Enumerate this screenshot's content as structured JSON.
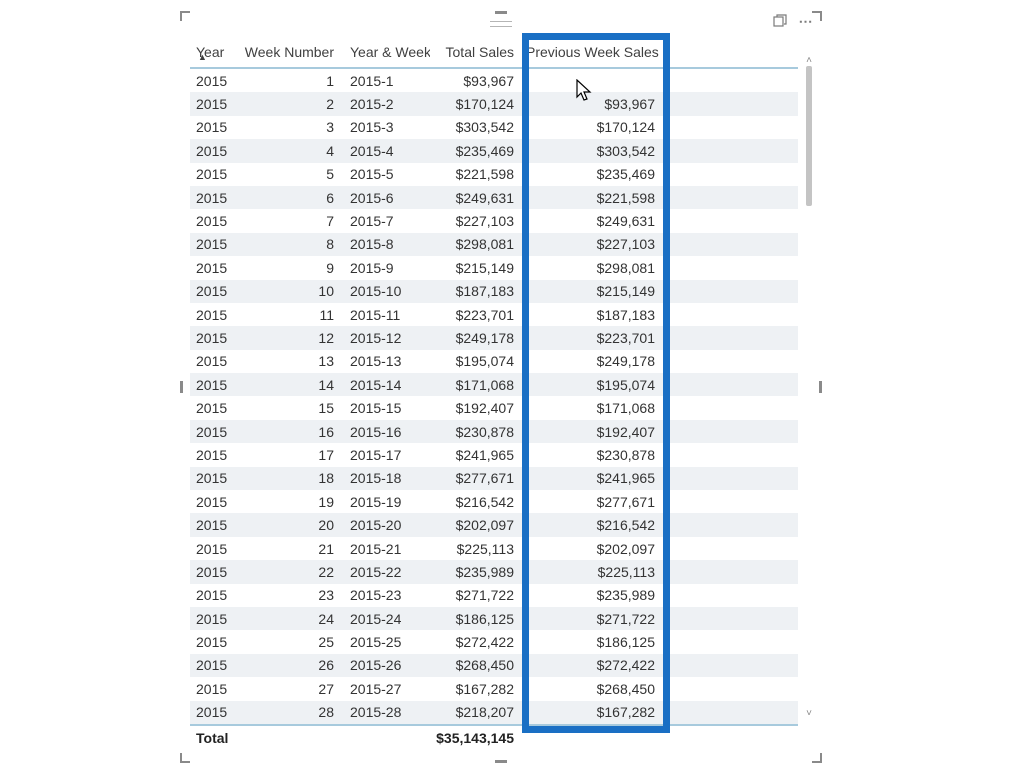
{
  "columns": {
    "year": "Year",
    "week_number": "Week Number",
    "year_week": "Year & Week",
    "total_sales": "Total Sales",
    "prev_week_sales": "Previous Week Sales"
  },
  "sort_indicator": "▲",
  "rows": [
    {
      "year": "2015",
      "week": "1",
      "yw": "2015-1",
      "total": "$93,967",
      "prev": ""
    },
    {
      "year": "2015",
      "week": "2",
      "yw": "2015-2",
      "total": "$170,124",
      "prev": "$93,967"
    },
    {
      "year": "2015",
      "week": "3",
      "yw": "2015-3",
      "total": "$303,542",
      "prev": "$170,124"
    },
    {
      "year": "2015",
      "week": "4",
      "yw": "2015-4",
      "total": "$235,469",
      "prev": "$303,542"
    },
    {
      "year": "2015",
      "week": "5",
      "yw": "2015-5",
      "total": "$221,598",
      "prev": "$235,469"
    },
    {
      "year": "2015",
      "week": "6",
      "yw": "2015-6",
      "total": "$249,631",
      "prev": "$221,598"
    },
    {
      "year": "2015",
      "week": "7",
      "yw": "2015-7",
      "total": "$227,103",
      "prev": "$249,631"
    },
    {
      "year": "2015",
      "week": "8",
      "yw": "2015-8",
      "total": "$298,081",
      "prev": "$227,103"
    },
    {
      "year": "2015",
      "week": "9",
      "yw": "2015-9",
      "total": "$215,149",
      "prev": "$298,081"
    },
    {
      "year": "2015",
      "week": "10",
      "yw": "2015-10",
      "total": "$187,183",
      "prev": "$215,149"
    },
    {
      "year": "2015",
      "week": "11",
      "yw": "2015-11",
      "total": "$223,701",
      "prev": "$187,183"
    },
    {
      "year": "2015",
      "week": "12",
      "yw": "2015-12",
      "total": "$249,178",
      "prev": "$223,701"
    },
    {
      "year": "2015",
      "week": "13",
      "yw": "2015-13",
      "total": "$195,074",
      "prev": "$249,178"
    },
    {
      "year": "2015",
      "week": "14",
      "yw": "2015-14",
      "total": "$171,068",
      "prev": "$195,074"
    },
    {
      "year": "2015",
      "week": "15",
      "yw": "2015-15",
      "total": "$192,407",
      "prev": "$171,068"
    },
    {
      "year": "2015",
      "week": "16",
      "yw": "2015-16",
      "total": "$230,878",
      "prev": "$192,407"
    },
    {
      "year": "2015",
      "week": "17",
      "yw": "2015-17",
      "total": "$241,965",
      "prev": "$230,878"
    },
    {
      "year": "2015",
      "week": "18",
      "yw": "2015-18",
      "total": "$277,671",
      "prev": "$241,965"
    },
    {
      "year": "2015",
      "week": "19",
      "yw": "2015-19",
      "total": "$216,542",
      "prev": "$277,671"
    },
    {
      "year": "2015",
      "week": "20",
      "yw": "2015-20",
      "total": "$202,097",
      "prev": "$216,542"
    },
    {
      "year": "2015",
      "week": "21",
      "yw": "2015-21",
      "total": "$225,113",
      "prev": "$202,097"
    },
    {
      "year": "2015",
      "week": "22",
      "yw": "2015-22",
      "total": "$235,989",
      "prev": "$225,113"
    },
    {
      "year": "2015",
      "week": "23",
      "yw": "2015-23",
      "total": "$271,722",
      "prev": "$235,989"
    },
    {
      "year": "2015",
      "week": "24",
      "yw": "2015-24",
      "total": "$186,125",
      "prev": "$271,722"
    },
    {
      "year": "2015",
      "week": "25",
      "yw": "2015-25",
      "total": "$272,422",
      "prev": "$186,125"
    },
    {
      "year": "2015",
      "week": "26",
      "yw": "2015-26",
      "total": "$268,450",
      "prev": "$272,422"
    },
    {
      "year": "2015",
      "week": "27",
      "yw": "2015-27",
      "total": "$167,282",
      "prev": "$268,450"
    },
    {
      "year": "2015",
      "week": "28",
      "yw": "2015-28",
      "total": "$218,207",
      "prev": "$167,282"
    }
  ],
  "totals": {
    "label": "Total",
    "total_sales": "$35,143,145",
    "prev_week_sales": ""
  },
  "icons": {
    "focus_mode": "focus-mode-icon",
    "more": "⋯"
  }
}
